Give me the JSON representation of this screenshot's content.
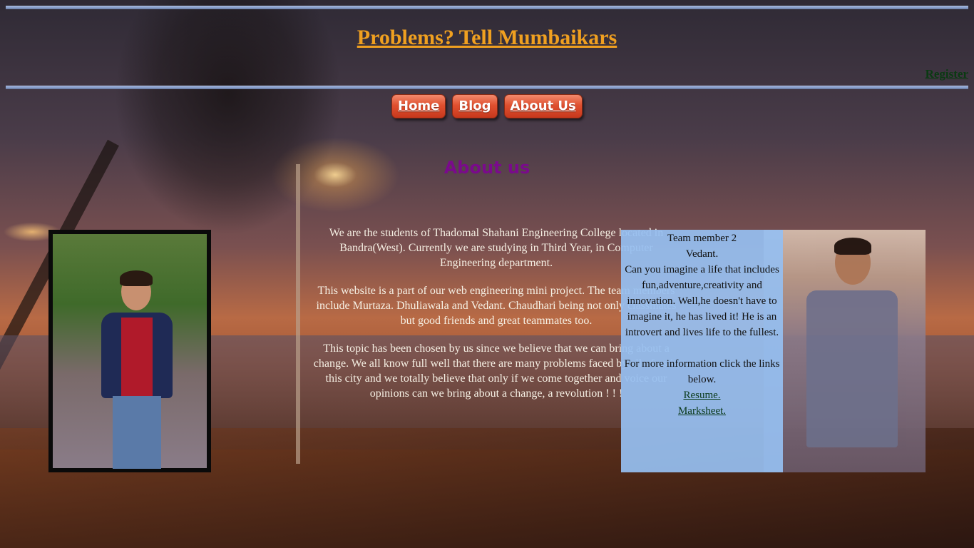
{
  "header": {
    "title": "Problems? Tell Mumbaikars",
    "register_label": "Register"
  },
  "nav": {
    "items": [
      {
        "label": "Home"
      },
      {
        "label": "Blog"
      },
      {
        "label": "About Us"
      }
    ]
  },
  "main": {
    "heading": "About us",
    "paragraphs": [
      "We are the students of Thadomal Shahani Engineering College located in Bandra(West). Currently we are studying in Third Year, in Computer Engineering department.",
      "This website is a part of our web engineering mini project. The team members include Murtaza. Dhuliawala and Vedant. Chaudhari being not only classmates but good friends and great teammates too.",
      "This topic has been chosen by us since we believe that we can bring about a change. We all know full well that there are many problems faced by all of us in this city and we totally believe that only if we come together and voice our opinions can we bring about a change, a revolution ! ! !"
    ]
  },
  "team_member_2": {
    "label": "Team member 2",
    "name": "Vedant.",
    "bio": "Can you imagine a life that includes fun,adventure,creativity and innovation. Well,he doesn't have to imagine it, he has lived it! He is an introvert and lives life to the fullest.",
    "more_info": "For more information click the links below.",
    "resume_label": "Resume.",
    "marksheet_label": "Marksheet."
  },
  "colors": {
    "title": "#f0a020",
    "register": "#0a3a12",
    "heading": "#7a0a8c",
    "nav_button": "#e0502f",
    "card_bg": "#96bef0"
  }
}
